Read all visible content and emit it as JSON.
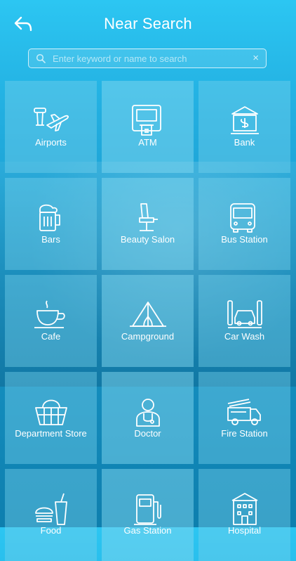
{
  "header": {
    "title": "Near Search"
  },
  "search": {
    "placeholder": "Enter keyword or name to search",
    "value": "",
    "clear_label": "×"
  },
  "categories": [
    {
      "label": "Airports",
      "icon": "airport-icon"
    },
    {
      "label": "ATM",
      "icon": "atm-icon"
    },
    {
      "label": "Bank",
      "icon": "bank-icon"
    },
    {
      "label": "Bars",
      "icon": "beer-mug-icon"
    },
    {
      "label": "Beauty Salon",
      "icon": "salon-chair-icon"
    },
    {
      "label": "Bus Station",
      "icon": "bus-icon"
    },
    {
      "label": "Cafe",
      "icon": "coffee-cup-icon"
    },
    {
      "label": "Campground",
      "icon": "tent-icon"
    },
    {
      "label": "Car Wash",
      "icon": "car-wash-icon"
    },
    {
      "label": "Department Store",
      "icon": "shopping-basket-icon"
    },
    {
      "label": "Doctor",
      "icon": "doctor-icon"
    },
    {
      "label": "Fire Station",
      "icon": "fire-truck-icon"
    },
    {
      "label": "Food",
      "icon": "fast-food-icon"
    },
    {
      "label": "Gas Station",
      "icon": "gas-pump-icon"
    },
    {
      "label": "Hospital",
      "icon": "hospital-building-icon"
    }
  ]
}
